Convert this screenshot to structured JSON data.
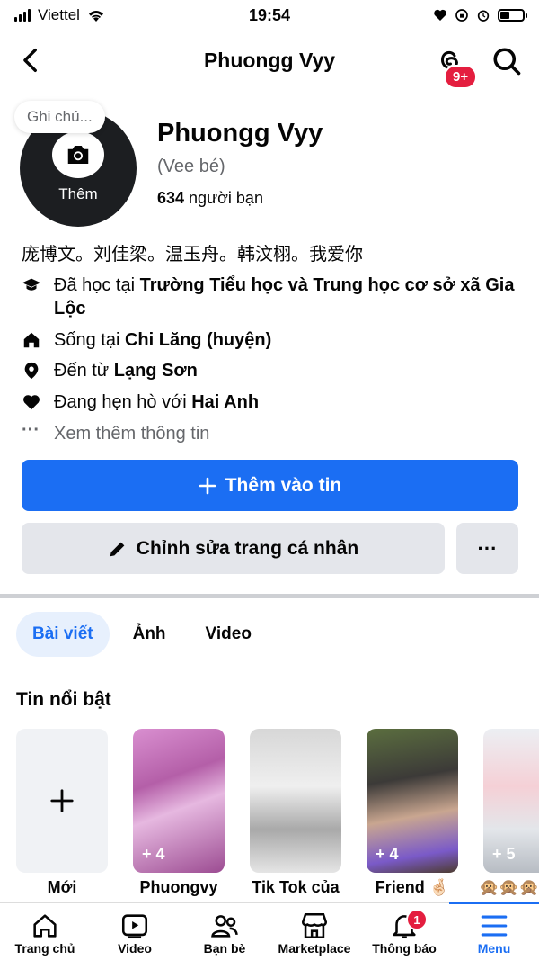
{
  "status_bar": {
    "carrier": "Viettel",
    "time": "19:54"
  },
  "header": {
    "title": "Phuongg Vyy",
    "threads_badge": "9+"
  },
  "profile": {
    "note_placeholder": "Ghi chú...",
    "avatar_action": "Thêm",
    "name": "Phuongg Vyy",
    "nickname": "(Vee bé)",
    "friends_count": "634",
    "friends_label": " người bạn",
    "bio": "庞博文。刘佳梁。温玉舟。韩汶栩。我爱你"
  },
  "info": [
    {
      "icon": "graduation-cap-icon",
      "prefix": "Đã học tại ",
      "value": "Trường Tiểu học và Trung học cơ sở xã Gia Lộc"
    },
    {
      "icon": "home-icon",
      "prefix": "Sống tại ",
      "value": "Chi Lăng (huyện)"
    },
    {
      "icon": "location-pin-icon",
      "prefix": "Đến từ ",
      "value": "Lạng Sơn"
    },
    {
      "icon": "heart-icon",
      "prefix": "Đang hẹn hò với ",
      "value": "Hai Anh"
    }
  ],
  "see_more_info": "Xem thêm thông tin",
  "buttons": {
    "add_story": "Thêm vào tin",
    "edit_profile": "Chỉnh sửa trang cá nhân",
    "more": "···"
  },
  "tabs": [
    "Bài viết",
    "Ảnh",
    "Video"
  ],
  "highlights": {
    "title": "Tin nổi bật",
    "items": [
      {
        "label": "Mới",
        "count": ""
      },
      {
        "label": "Phuongvy",
        "count": "+ 4"
      },
      {
        "label": "Tik Tok của",
        "count": ""
      },
      {
        "label": "Friend 🤞🏻",
        "count": "+ 4"
      },
      {
        "label": "🙊🙊🙊",
        "count": "+ 5"
      }
    ]
  },
  "bottom_nav": [
    {
      "label": "Trang chủ",
      "icon": "home-icon"
    },
    {
      "label": "Video",
      "icon": "video-icon"
    },
    {
      "label": "Bạn bè",
      "icon": "friends-icon"
    },
    {
      "label": "Marketplace",
      "icon": "marketplace-icon"
    },
    {
      "label": "Thông báo",
      "icon": "bell-icon",
      "badge": "1"
    },
    {
      "label": "Menu",
      "icon": "menu-icon"
    }
  ],
  "colors": {
    "accent": "#1b6ef3",
    "badge": "#e41e3f",
    "secondary_button": "#e4e6eb"
  }
}
